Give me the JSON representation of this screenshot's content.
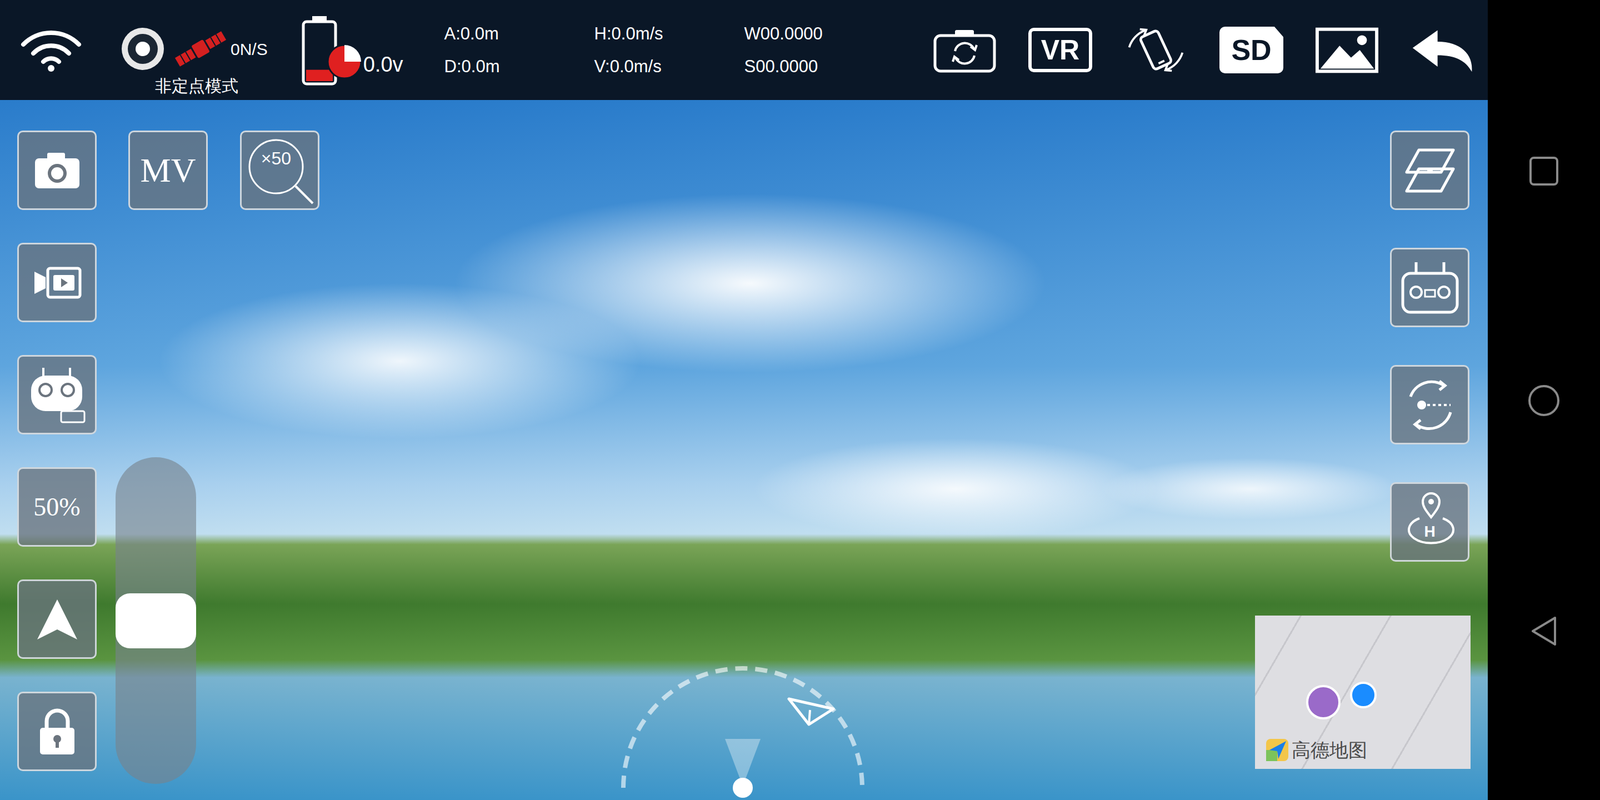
{
  "status_bar": {
    "satellites": "0N/S",
    "mode": "非定点模式",
    "voltage": "0.0v",
    "battery": {
      "level": 0.2
    }
  },
  "telemetry": [
    "A:0.0m",
    "D:0.0m",
    "H:0.0m/s",
    "V:0.0m/s",
    "W00.0000",
    "S00.0000"
  ],
  "toolbar": {
    "vr": "VR",
    "sd": "SD"
  },
  "left_panel": {
    "mv": "MV",
    "zoom": "×50",
    "speed": "50%",
    "throttle": {
      "level": 0.5
    }
  },
  "right_panel": {
    "home": "H"
  },
  "map": {
    "logo": "高德地图"
  }
}
